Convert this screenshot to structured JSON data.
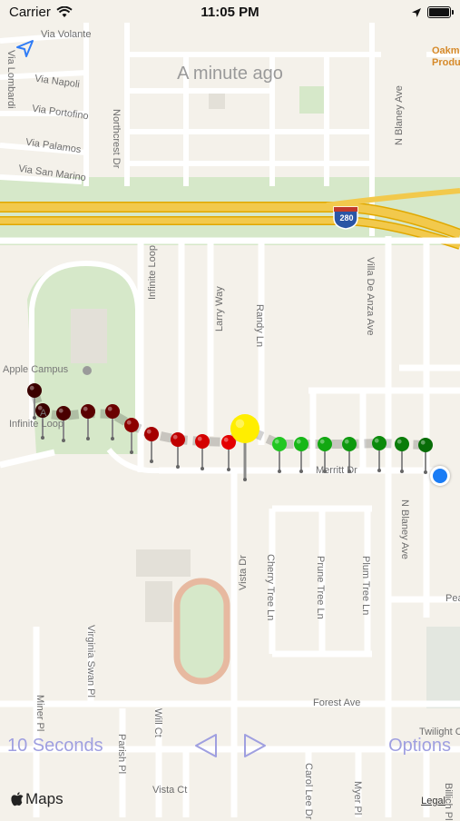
{
  "status_bar": {
    "carrier": "Carrier",
    "time": "11:05 PM"
  },
  "overlay": {
    "timestamp": "A minute ago",
    "duration_label": "10 Seconds",
    "options_label": "Options"
  },
  "map": {
    "street_labels": {
      "via_volante": "Via Volante",
      "via_lombardi": "Via Lombardi",
      "via_napoli": "Via Napoli",
      "via_portofino": "Via Portofino",
      "via_palamos": "Via Palamos",
      "via_san_marino": "Via San Marino",
      "northcrest_dr": "Northcrest Dr",
      "n_blaney_ave_top": "N Blaney Ave",
      "villa_de_anza": "Villa De Anza Ave",
      "infinite_loop_road": "Infinite Loop",
      "larry_way": "Larry Way",
      "randy_ln": "Randy Ln",
      "merritt_dr": "Merritt Dr",
      "vista_dr": "Vista Dr",
      "cherry_tree_ln": "Cherry Tree Ln",
      "prune_tree_ln": "Prune Tree Ln",
      "plum_tree_ln": "Plum Tree Ln",
      "n_blaney_ave": "N Blaney Ave",
      "virginia_swan_pl": "Virginia Swan Pl",
      "miner_pl": "Miner Pl",
      "parish_pl": "Parish Pl",
      "will_ct": "Will Ct",
      "forest_ave": "Forest Ave",
      "vista_ct": "Vista Ct",
      "carol_lee_dr": "Carol Lee Dr",
      "myer_pl": "Myer Pl",
      "twilight_ct": "Twilight Ct",
      "billich_pl": "Billich Pl",
      "peal": "Peal"
    },
    "poi": {
      "apple_campus": "Apple Campus",
      "infinite_loop_a": "A",
      "infinite_loop_b": "Infinite Loop",
      "oakmont_1": "Oakm",
      "oakmont_2": "Produce"
    },
    "highway_shield": "280",
    "colors": {
      "road": "#ffffff",
      "highway": "#f2c94c",
      "highway_edge": "#e0a800",
      "green_area": "#d6e8c9",
      "land": "#f4f1ea",
      "interstate_shield": "#2a55a5"
    }
  },
  "pins": {
    "count": 18,
    "colors": [
      "#3b0000",
      "#3b0000",
      "#4a0000",
      "#5a0000",
      "#6a0000",
      "#8c0000",
      "#a50000",
      "#c00000",
      "#d40000",
      "#e40000",
      "#ffee00",
      "#22c722",
      "#17b717",
      "#12a812",
      "#0e990e",
      "#0b8a0b",
      "#097c09",
      "#086d08"
    ]
  },
  "bottom": {
    "logo_text": "Maps",
    "legal": "Legal"
  }
}
